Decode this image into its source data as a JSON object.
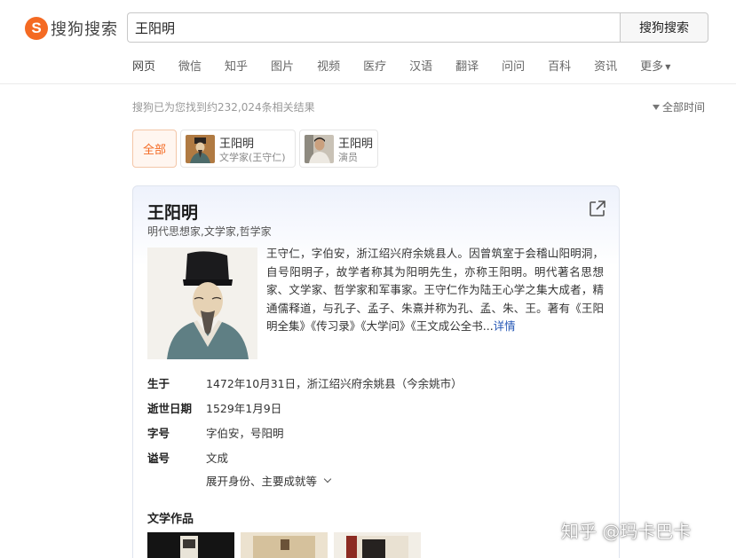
{
  "header": {
    "logo_text": "搜狗搜索",
    "logo_mark": "S",
    "search_value": "王阳明",
    "search_button": "搜狗搜索"
  },
  "nav": {
    "items": [
      "网页",
      "微信",
      "知乎",
      "图片",
      "视频",
      "医疗",
      "汉语",
      "翻译",
      "问问",
      "百科",
      "资讯"
    ],
    "more": "更多"
  },
  "results": {
    "count_text": "搜狗已为您找到约232,024条相关结果",
    "time_filter": "全部时间"
  },
  "entity_chips": {
    "all_label": "全部",
    "items": [
      {
        "name": "王阳明",
        "desc": "文学家(王守仁)"
      },
      {
        "name": "王阳明",
        "desc": "演员"
      }
    ]
  },
  "card": {
    "title": "王阳明",
    "subtitle": "明代思想家,文学家,哲学家",
    "summary": "王守仁，字伯安，浙江绍兴府余姚县人。因曾筑室于会稽山阳明洞，自号阳明子，故学者称其为阳明先生，亦称王阳明。明代著名思想家、文学家、哲学家和军事家。王守仁作为陆王心学之集大成者，精通儒释道，与孔子、孟子、朱熹并称为孔、孟、朱、王。著有《王阳明全集》《传习录》《大学问》《王文成公全书...",
    "detail_link": "详情",
    "facts": [
      {
        "key": "生于",
        "value": "1472年10月31日，浙江绍兴府余姚县（今余姚市）"
      },
      {
        "key": "逝世日期",
        "value": "1529年1月9日"
      },
      {
        "key": "字号",
        "value": "字伯安，号阳明"
      },
      {
        "key": "谥号",
        "value": "文成"
      }
    ],
    "expand_label": "展开身份、主要成就等",
    "works_title": "文学作品"
  },
  "watermark": "知乎 @玛卡巴卡",
  "colors": {
    "brand": "#f46a23",
    "link": "#2456b5",
    "card_gradient_top": "#eef2fc"
  },
  "icons": [
    "sogou-logo-icon",
    "funnel-icon",
    "share-icon",
    "chevron-down-icon"
  ]
}
